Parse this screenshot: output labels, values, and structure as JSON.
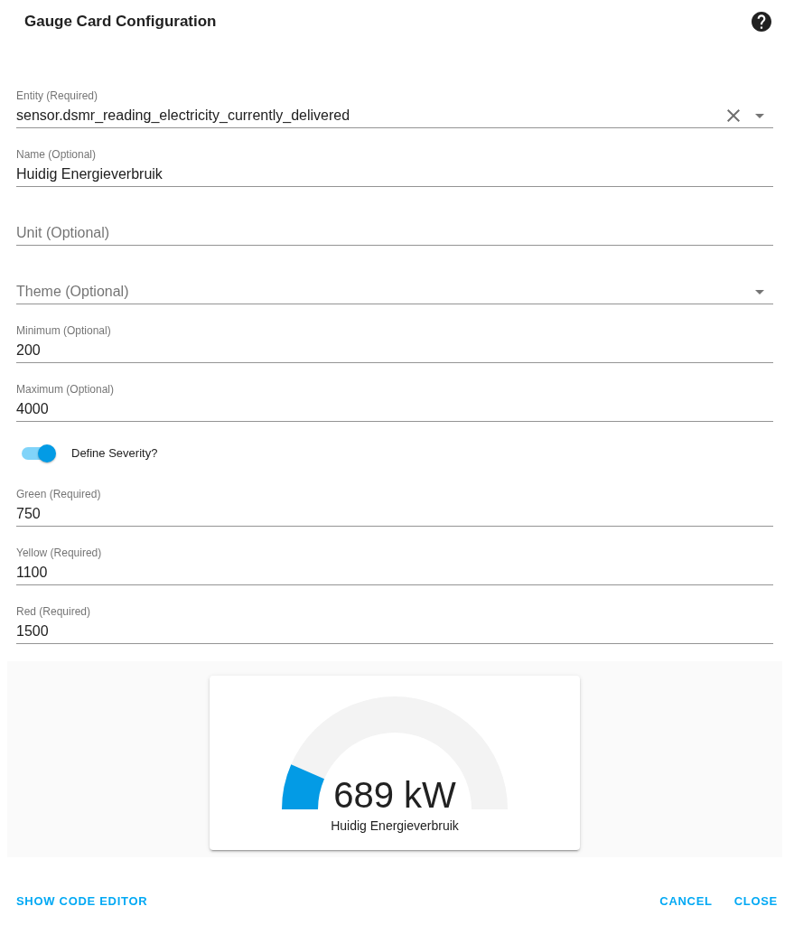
{
  "dialog": {
    "title": "Gauge Card Configuration"
  },
  "fields": [
    {
      "kind": "entity",
      "label": "Entity (Required)",
      "value": "sensor.dsmr_reading_electricity_currently_delivered"
    },
    {
      "kind": "text",
      "label": "Name (Optional)",
      "value": "Huidig Energieverbruik"
    },
    {
      "kind": "text",
      "label": "Unit (Optional)"
    },
    {
      "kind": "select",
      "label": "Theme (Optional)"
    },
    {
      "kind": "text",
      "label": "Minimum (Optional)",
      "value": "200"
    },
    {
      "kind": "text",
      "label": "Maximum (Optional)",
      "value": "4000"
    },
    {
      "kind": "switch",
      "label": "Define Severity?",
      "on": true
    },
    {
      "kind": "text",
      "label": "Green (Required)",
      "value": "750"
    },
    {
      "kind": "text",
      "label": "Yellow (Required)",
      "value": "1100"
    },
    {
      "kind": "text",
      "label": "Red (Required)",
      "value": "1500"
    }
  ],
  "preview": {
    "reading": "689 kW",
    "name": "Huidig Energieverbruik",
    "level": 0.13
  },
  "actions": {
    "left": [
      "SHOW CODE EDITOR"
    ],
    "right": [
      "CANCEL",
      "CLOSE"
    ]
  }
}
